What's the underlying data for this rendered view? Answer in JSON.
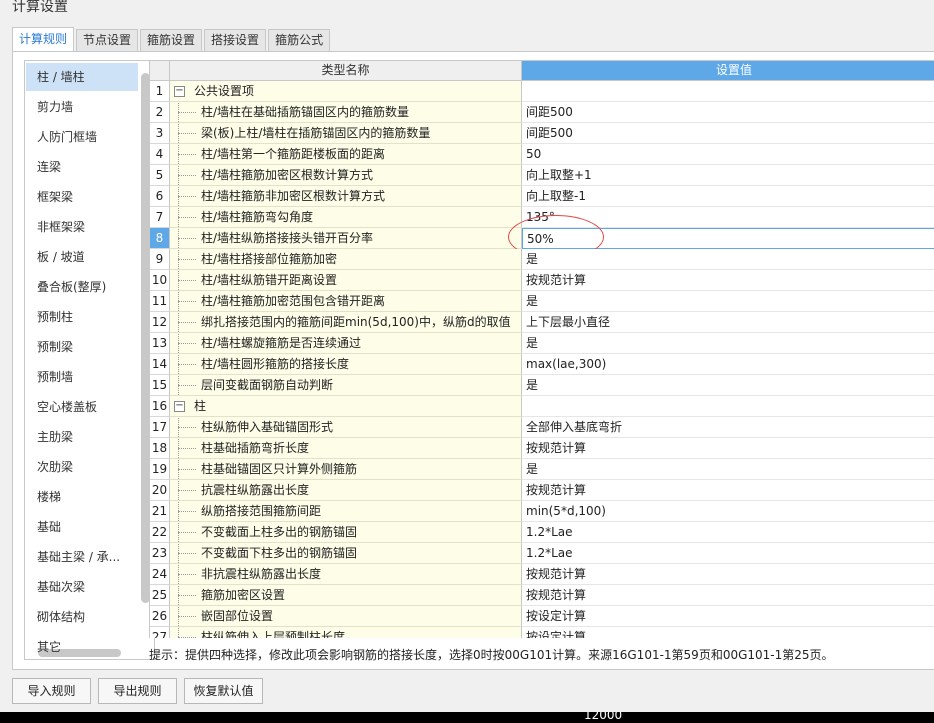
{
  "window": {
    "title": "计算设置"
  },
  "tabs": [
    {
      "label": "计算规则",
      "active": true
    },
    {
      "label": "节点设置"
    },
    {
      "label": "箍筋设置"
    },
    {
      "label": "搭接设置"
    },
    {
      "label": "箍筋公式"
    }
  ],
  "left_nav": {
    "items": [
      "柱 / 墙柱",
      "剪力墙",
      "人防门框墙",
      "连梁",
      "框架梁",
      "非框架梁",
      "板 / 坡道",
      "叠合板(整厚)",
      "预制柱",
      "预制梁",
      "预制墙",
      "空心楼盖板",
      "主肋梁",
      "次肋梁",
      "楼梯",
      "基础",
      "基础主梁 / 承...",
      "基础次梁",
      "砌体结构",
      "其它"
    ],
    "selected_index": 0
  },
  "grid": {
    "header": {
      "name": "类型名称",
      "value": "设置值"
    },
    "rows": [
      {
        "num": "1",
        "name": "公共设置项",
        "value": "",
        "group": true
      },
      {
        "num": "2",
        "name": "柱/墙柱在基础插筋锚固区内的箍筋数量",
        "value": "间距500"
      },
      {
        "num": "3",
        "name": "梁(板)上柱/墙柱在插筋锚固区内的箍筋数量",
        "value": "间距500"
      },
      {
        "num": "4",
        "name": "柱/墙柱第一个箍筋距楼板面的距离",
        "value": "50"
      },
      {
        "num": "5",
        "name": "柱/墙柱箍筋加密区根数计算方式",
        "value": "向上取整+1"
      },
      {
        "num": "6",
        "name": "柱/墙柱箍筋非加密区根数计算方式",
        "value": "向上取整-1"
      },
      {
        "num": "7",
        "name": "柱/墙柱箍筋弯勾角度",
        "value": "135°"
      },
      {
        "num": "8",
        "name": "柱/墙柱纵筋搭接接头错开百分率",
        "value": "50%",
        "selected": true
      },
      {
        "num": "9",
        "name": "柱/墙柱搭接部位箍筋加密",
        "value": "是"
      },
      {
        "num": "10",
        "name": "柱/墙柱纵筋错开距离设置",
        "value": "按规范计算"
      },
      {
        "num": "11",
        "name": "柱/墙柱箍筋加密范围包含错开距离",
        "value": "是"
      },
      {
        "num": "12",
        "name": "绑扎搭接范围内的箍筋间距min(5d,100)中，纵筋d的取值",
        "value": "上下层最小直径"
      },
      {
        "num": "13",
        "name": "柱/墙柱螺旋箍筋是否连续通过",
        "value": "是"
      },
      {
        "num": "14",
        "name": "柱/墙柱圆形箍筋的搭接长度",
        "value": "max(lae,300)"
      },
      {
        "num": "15",
        "name": "层间变截面钢筋自动判断",
        "value": "是"
      },
      {
        "num": "16",
        "name": "柱",
        "value": "",
        "group": true
      },
      {
        "num": "17",
        "name": "柱纵筋伸入基础锚固形式",
        "value": "全部伸入基底弯折"
      },
      {
        "num": "18",
        "name": "柱基础插筋弯折长度",
        "value": "按规范计算"
      },
      {
        "num": "19",
        "name": "柱基础锚固区只计算外侧箍筋",
        "value": "是"
      },
      {
        "num": "20",
        "name": "抗震柱纵筋露出长度",
        "value": "按规范计算"
      },
      {
        "num": "21",
        "name": "纵筋搭接范围箍筋间距",
        "value": "min(5*d,100)"
      },
      {
        "num": "22",
        "name": "不变截面上柱多出的钢筋锚固",
        "value": "1.2*Lae"
      },
      {
        "num": "23",
        "name": "不变截面下柱多出的钢筋锚固",
        "value": "1.2*Lae"
      },
      {
        "num": "24",
        "name": "非抗震柱纵筋露出长度",
        "value": "按规范计算"
      },
      {
        "num": "25",
        "name": "箍筋加密区设置",
        "value": "按规范计算"
      },
      {
        "num": "26",
        "name": "嵌固部位设置",
        "value": "按设定计算"
      },
      {
        "num": "27",
        "name": "柱纵筋伸入上层预制柱长度",
        "value": "按设定计算"
      }
    ]
  },
  "hint": "提示：提供四种选择，修改此项会影响钢筋的搭接长度，选择0时按00G101计算。来源16G101-1第59页和00G101-1第25页。",
  "buttons": {
    "import": "导入规则",
    "export": "导出规则",
    "reset": "恢复默认值"
  },
  "background": {
    "dimension_text": "12000"
  }
}
